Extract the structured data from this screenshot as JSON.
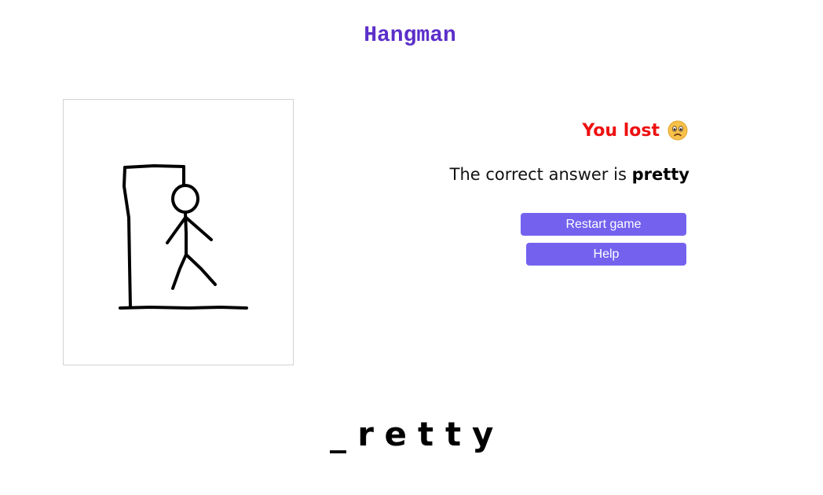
{
  "app": {
    "title": "Hangman"
  },
  "result": {
    "status_text": "You lost",
    "status_color": "#ee1010",
    "status_icon": "sad-face-icon",
    "answer_prefix": "The correct answer is",
    "answer_word": "pretty"
  },
  "buttons": {
    "restart_label": "Restart game",
    "help_label": "Help",
    "button_color": "#7462ef"
  },
  "word_display": {
    "letters": [
      "_",
      "r",
      "e",
      "t",
      "t",
      "y"
    ]
  },
  "drawing": {
    "icon": "hangman-figure",
    "wrong_guesses_shown": "complete figure"
  },
  "colors": {
    "title": "#5b2fc9"
  }
}
